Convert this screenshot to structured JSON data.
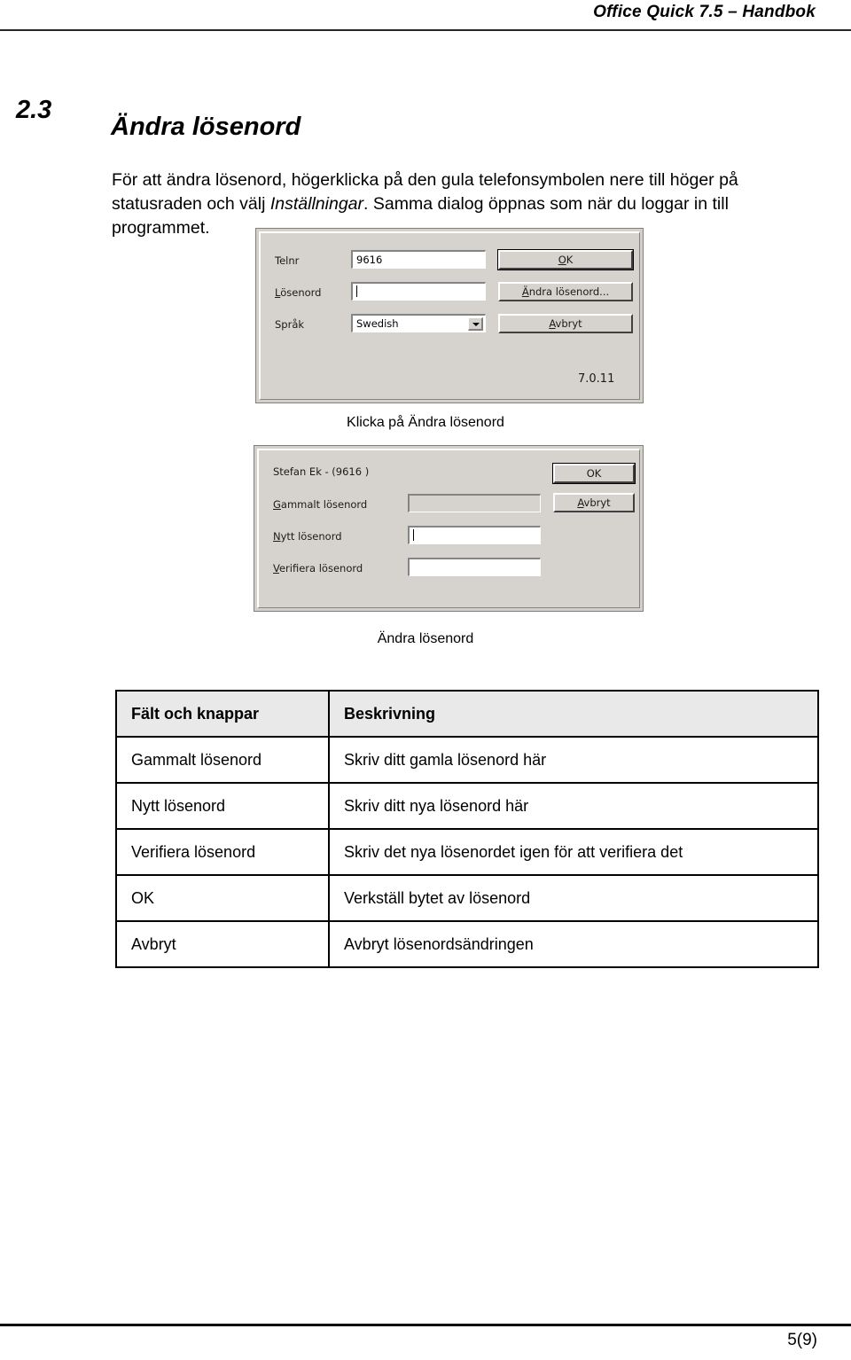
{
  "header": {
    "title": "Office Quick 7.5 – Handbok"
  },
  "section": {
    "number": "2.3",
    "title": "Ändra lösenord",
    "paragraph_part1": "För att ändra lösenord, högerklicka på den gula telefonsymbolen nere till höger på statusraden och välj ",
    "paragraph_emphasis": "Inställningar",
    "paragraph_part2": ". Samma dialog öppnas som när du loggar in till programmet."
  },
  "login_dialog": {
    "labels": {
      "telnr": "Telnr",
      "losenord": "Lösenord",
      "sprak": "Språk"
    },
    "values": {
      "telnr": "9616",
      "losenord": "",
      "sprak": "Swedish"
    },
    "buttons": {
      "ok": "OK",
      "change_password": "Ändra lösenord...",
      "cancel": "Avbryt"
    },
    "version": "7.0.11"
  },
  "caption_1": "Klicka på Ändra lösenord",
  "password_dialog": {
    "user_title": "Stefan Ek  -  (9616 )",
    "labels": {
      "old": "Gammalt lösenord",
      "new": "Nytt lösenord",
      "verify": "Verifiera lösenord"
    },
    "values": {
      "old": "",
      "new": "",
      "verify": ""
    },
    "buttons": {
      "ok": "OK",
      "cancel": "Avbryt"
    }
  },
  "caption_2": "Ändra lösenord",
  "table": {
    "headers": [
      "Fält och knappar",
      "Beskrivning"
    ],
    "rows": [
      [
        "Gammalt lösenord",
        "Skriv ditt gamla lösenord här"
      ],
      [
        "Nytt lösenord",
        "Skriv ditt nya lösenord här"
      ],
      [
        "Verifiera lösenord",
        "Skriv det nya lösenordet igen för att verifiera det"
      ],
      [
        "OK",
        "Verkställ bytet av lösenord"
      ],
      [
        "Avbryt",
        "Avbryt lösenordsändringen"
      ]
    ]
  },
  "footer": {
    "page": "5(9)"
  }
}
